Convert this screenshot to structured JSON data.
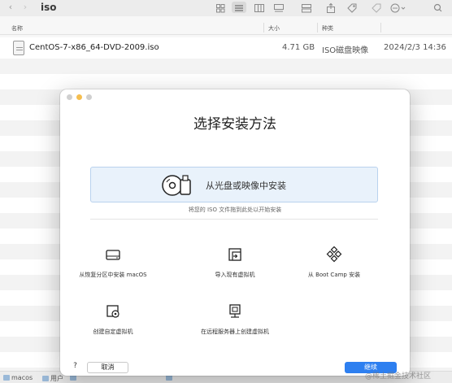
{
  "finder": {
    "title": "iso",
    "nav_back": "‹",
    "nav_forward": "›",
    "columns": {
      "name": "名称",
      "size": "大小",
      "kind": "种类",
      "date": ""
    },
    "file": {
      "name": "CentOS-7-x86_64-DVD-2009.iso",
      "size": "4.71 GB",
      "kind": "ISO磁盘映像",
      "date": "2024/2/3 14:36"
    },
    "pathbar": [
      "macos",
      "用户",
      "",
      ""
    ]
  },
  "dialog": {
    "title": "选择安装方法",
    "disc_option_label": "从光盘或映像中安装",
    "drop_hint": "将您的 ISO 文件拖到此处以开始安装",
    "options": [
      {
        "label": "从恢复分区中安装 macOS",
        "icon": "hard-drive-icon"
      },
      {
        "label": "导入现有虚拟机",
        "icon": "import-vm-icon"
      },
      {
        "label": "从 Boot Camp 安装",
        "icon": "boot-camp-icon"
      },
      {
        "label": "创建自定虚拟机",
        "icon": "custom-vm-icon"
      },
      {
        "label": "在远程服务器上创建虚拟机",
        "icon": "remote-server-icon"
      }
    ],
    "help_label": "?",
    "cancel_label": "取消",
    "continue_label": "继续"
  },
  "watermark": "@稀土掘金技术社区",
  "colors": {
    "accent": "#2d7ff0",
    "drop_zone_bg": "#e9f2fb",
    "traffic_yellow": "#f5be4f"
  }
}
